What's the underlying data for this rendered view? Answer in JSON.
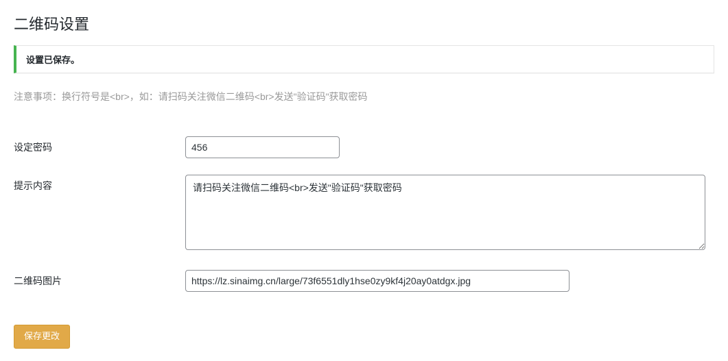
{
  "page": {
    "title": "二维码设置"
  },
  "notice": {
    "message": "设置已保存。"
  },
  "hint": "注意事项：换行符号是<br>，如：请扫码关注微信二维码<br>发送\"验证码\"获取密码",
  "form": {
    "password": {
      "label": "设定密码",
      "value": "456"
    },
    "prompt": {
      "label": "提示内容",
      "value": "请扫码关注微信二维码<br>发送\"验证码\"获取密码"
    },
    "qrcode_image": {
      "label": "二维码图片",
      "value": "https://lz.sinaimg.cn/large/73f6551dly1hse0zy9kf4j20ay0atdgx.jpg"
    },
    "submit_label": "保存更改"
  }
}
